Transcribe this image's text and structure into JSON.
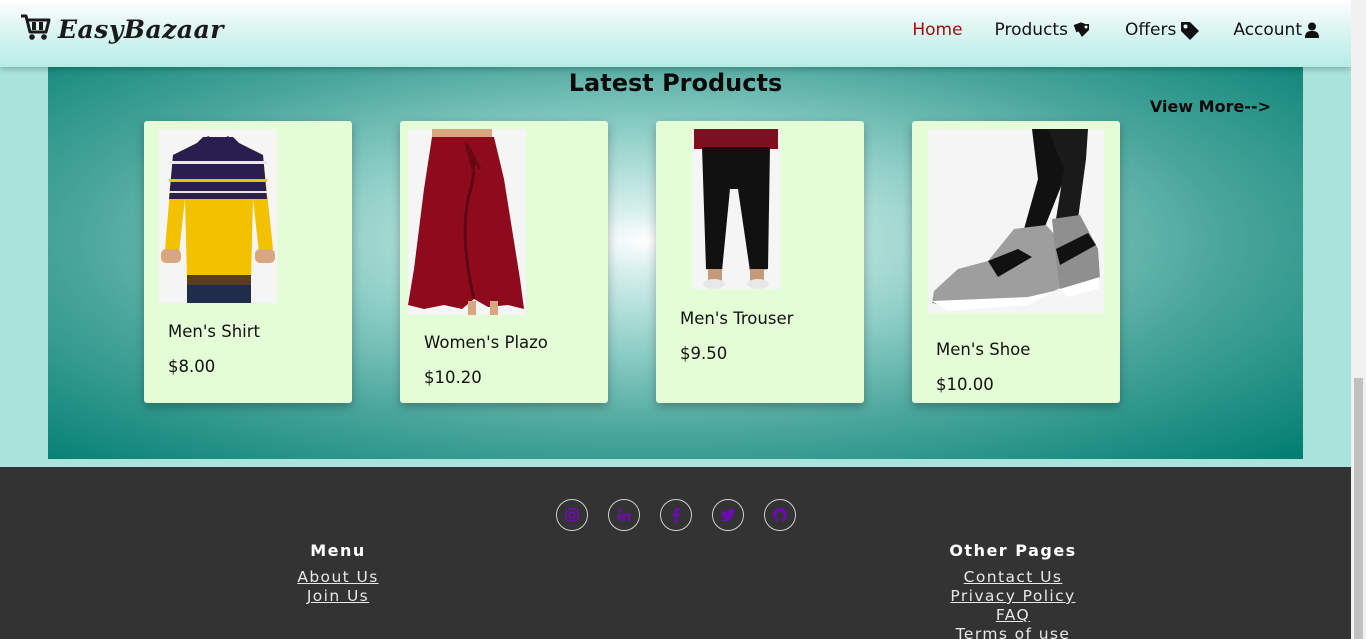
{
  "brand": {
    "name": "EasyBazaar",
    "logo_icon": "shopping-cart-icon"
  },
  "nav": {
    "items": [
      {
        "label": "Home",
        "icon": "",
        "active": true
      },
      {
        "label": "Products",
        "icon": "tags-icon",
        "active": false
      },
      {
        "label": "Offers",
        "icon": "tag-icon",
        "active": false
      },
      {
        "label": "Account",
        "icon": "user-icon",
        "active": false
      }
    ],
    "active_color": "#9a0e0e"
  },
  "latest": {
    "title": "Latest Products",
    "view_more": "View More-->",
    "products": [
      {
        "name": "Men's Shirt",
        "price": "$8.00"
      },
      {
        "name": "Women's Plazo",
        "price": "$10.20"
      },
      {
        "name": "Men's Trouser",
        "price": "$9.50"
      },
      {
        "name": "Men's Shoe",
        "price": "$10.00"
      }
    ]
  },
  "footer": {
    "social": [
      "instagram-icon",
      "linkedin-icon",
      "facebook-icon",
      "twitter-icon",
      "github-icon"
    ],
    "social_icon_color": "#6a0dad",
    "menu": {
      "title": "Menu",
      "links": [
        "About Us",
        "Join Us"
      ]
    },
    "other": {
      "title": "Other Pages",
      "links": [
        "Contact Us",
        "Privacy Policy",
        "FAQ",
        "Terms of use"
      ]
    }
  },
  "colors": {
    "card_bg": "#e4fdd6",
    "footer_bg": "#333333",
    "panel_edge": "#007d70"
  }
}
